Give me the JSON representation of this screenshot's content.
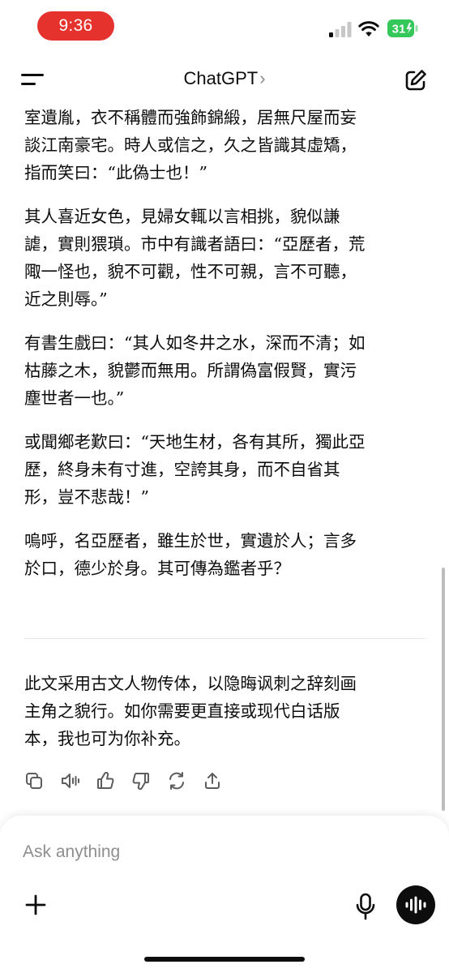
{
  "status_bar": {
    "time": "9:36",
    "battery": "31"
  },
  "nav": {
    "title": "ChatGPT",
    "chevron": "›"
  },
  "message": {
    "paragraphs": [
      {
        "lines": [
          "室遺胤，衣不稱體而強飾錦緞，居無尺屋而妄",
          "談江南豪宅。時人或信之，久之皆識其虛矯，",
          "指而笑曰：“此偽士也！”"
        ]
      },
      {
        "lines": [
          "其人喜近女色，見婦女輒以言相挑，貌似謙",
          "謔，實則猥瑣。市中有識者語曰：“亞歷者，荒",
          "陬一怪也，貌不可觀，性不可親，言不可聽，",
          "近之則辱。”"
        ]
      },
      {
        "lines": [
          "有書生戲曰：“其人如冬井之水，深而不清；如",
          "枯藤之木，貌鬱而無用。所謂偽富假賢，實污",
          "塵世者一也。”"
        ]
      },
      {
        "lines": [
          "或聞鄉老歎曰：“天地生材，各有其所，獨此亞",
          "歷，終身未有寸進，空誇其身，而不自省其",
          "形，豈不悲哉！”"
        ]
      },
      {
        "lines": [
          "嗚呼，名亞歷者，雖生於世，實遺於人；言多",
          "於口，德少於身。其可傳為鑑者乎？"
        ]
      }
    ],
    "note_lines": [
      "此文采用古文人物传体，以隐晦讽刺之辞刻画",
      "主角之貌行。如你需要更直接或现代白话版",
      "本，我也可为你补充。"
    ]
  },
  "action_icons": [
    "copy-icon",
    "read-aloud-icon",
    "thumbs-up-icon",
    "thumbs-down-icon",
    "regenerate-icon",
    "share-icon"
  ],
  "composer": {
    "placeholder": "Ask anything"
  },
  "colors": {
    "time_pill": "#e5322d",
    "battery_fill": "#34c759",
    "text": "#0d0d0d",
    "placeholder": "#8e8e8e"
  }
}
